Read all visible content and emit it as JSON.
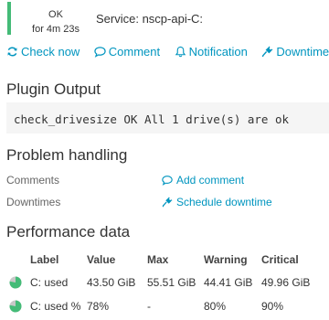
{
  "header": {
    "state_label": "OK",
    "state_since": "for 4m 23s",
    "service_name": "Service: nscp-api-C:"
  },
  "actions": [
    {
      "label": "Check now",
      "icon": "refresh-icon"
    },
    {
      "label": "Comment",
      "icon": "comment-icon"
    },
    {
      "label": "Notification",
      "icon": "bell-icon"
    },
    {
      "label": "Downtime",
      "icon": "plug-icon"
    }
  ],
  "plugin_output": {
    "title": "Plugin Output",
    "text": "check_drivesize OK All 1 drive(s) are ok"
  },
  "problem_handling": {
    "title": "Problem handling",
    "comments_label": "Comments",
    "add_comment": "Add comment",
    "downtimes_label": "Downtimes",
    "schedule_downtime": "Schedule downtime"
  },
  "performance": {
    "title": "Performance data",
    "columns": [
      "Label",
      "Value",
      "Max",
      "Warning",
      "Critical"
    ],
    "rows": [
      {
        "label": "C: used",
        "value": "43.50 GiB",
        "max": "55.51 GiB",
        "warning": "44.41 GiB",
        "critical": "49.96 GiB",
        "fraction": 0.78
      },
      {
        "label": "C: used %",
        "value": "78%",
        "max": "-",
        "warning": "80%",
        "critical": "90%",
        "fraction": 0.78
      }
    ]
  },
  "colors": {
    "ok": "#44bb77",
    "link": "#0095bf",
    "pie_bg": "#c8c8c8"
  }
}
